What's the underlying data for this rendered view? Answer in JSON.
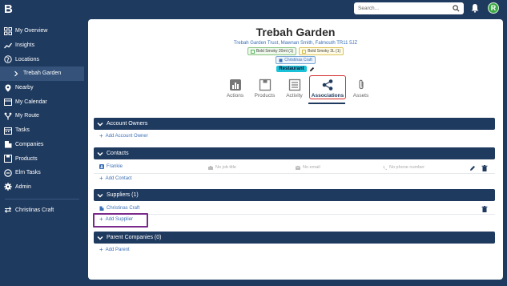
{
  "app": {
    "logo": "B"
  },
  "topbar": {
    "search_placeholder": "Search...",
    "avatar_initial": "R"
  },
  "sidebar": {
    "items": [
      {
        "label": "My Overview"
      },
      {
        "label": "Insights"
      },
      {
        "label": "Locations"
      },
      {
        "label": "Trebah Garden"
      },
      {
        "label": "Nearby"
      },
      {
        "label": "My Calendar"
      },
      {
        "label": "My Route"
      },
      {
        "label": "Tasks"
      },
      {
        "label": "Companies"
      },
      {
        "label": "Products"
      },
      {
        "label": "Elm Tasks"
      },
      {
        "label": "Admin"
      }
    ],
    "footer_item": "Christinas Craft"
  },
  "location": {
    "title": "Trebah Garden",
    "address": "Trebah Garden Trust, Mawnan Smith, Falmouth TR11 5JZ",
    "product_chips": [
      "Bold Smoky 20ml (1)",
      "Bold Smoky 3L (1)"
    ],
    "company_chip": "Christinas Craft",
    "tag": "Restaurant"
  },
  "tabs": [
    {
      "label": "Actions"
    },
    {
      "label": "Products"
    },
    {
      "label": "Activity"
    },
    {
      "label": "Associations"
    },
    {
      "label": "Assets"
    }
  ],
  "sections": {
    "account_owners": {
      "title": "Account Owners",
      "add_label": "Add Account Owner"
    },
    "contacts": {
      "title": "Contacts",
      "contact_name": "Frankie",
      "job_title": "No job title",
      "email": "No email",
      "phone": "No phone number",
      "add_label": "Add Contact"
    },
    "suppliers": {
      "title": "Suppliers (1)",
      "supplier_name": "Christinas Craft",
      "add_label": "Add Supplier"
    },
    "parent_companies": {
      "title": "Parent Companies (0)",
      "add_label": "Add Parent"
    }
  },
  "colors": {
    "primary": "#1f3a5f",
    "link": "#3b6fb5",
    "highlight": "#7b2a8c",
    "active_tab_border": "#d42a2a",
    "tag": "#19c2d8"
  }
}
